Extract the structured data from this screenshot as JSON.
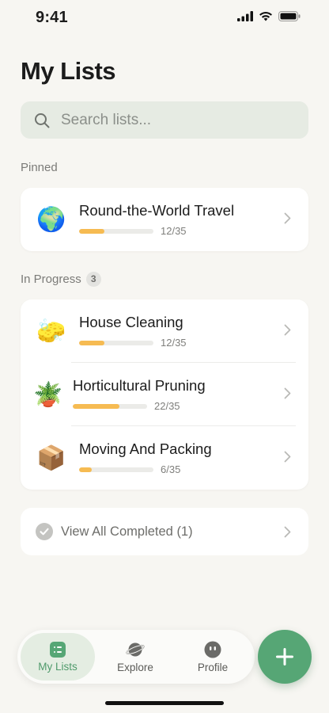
{
  "status_bar": {
    "time": "9:41"
  },
  "page_title": "My Lists",
  "search": {
    "placeholder": "Search lists..."
  },
  "pinned": {
    "label": "Pinned",
    "items": [
      {
        "emoji": "🌍",
        "icon": "globe-icon",
        "title": "Round-the-World Travel",
        "progress_text": "12/35",
        "progress": 0.343
      }
    ]
  },
  "in_progress": {
    "label": "In Progress",
    "count": "3",
    "items": [
      {
        "emoji": "🧽",
        "icon": "cleaning-bucket-icon",
        "title": "House Cleaning",
        "progress_text": "12/35",
        "progress": 0.343
      },
      {
        "emoji": "🪴",
        "icon": "potted-plant-icon",
        "title": "Horticultural Pruning",
        "progress_text": "22/35",
        "progress": 0.629
      },
      {
        "emoji": "📦",
        "icon": "box-icon",
        "title": "Moving And Packing",
        "progress_text": "6/35",
        "progress": 0.171
      }
    ]
  },
  "completed": {
    "label": "View All Completed (1)"
  },
  "tab_bar": {
    "tabs": [
      {
        "label": "My Lists",
        "icon": "list-icon",
        "active": true
      },
      {
        "label": "Explore",
        "icon": "planet-icon",
        "active": false
      },
      {
        "label": "Profile",
        "icon": "face-icon",
        "active": false
      }
    ]
  },
  "colors": {
    "accent": "#56a675",
    "progress": "#f6bb52",
    "background": "#f7f6f2"
  }
}
